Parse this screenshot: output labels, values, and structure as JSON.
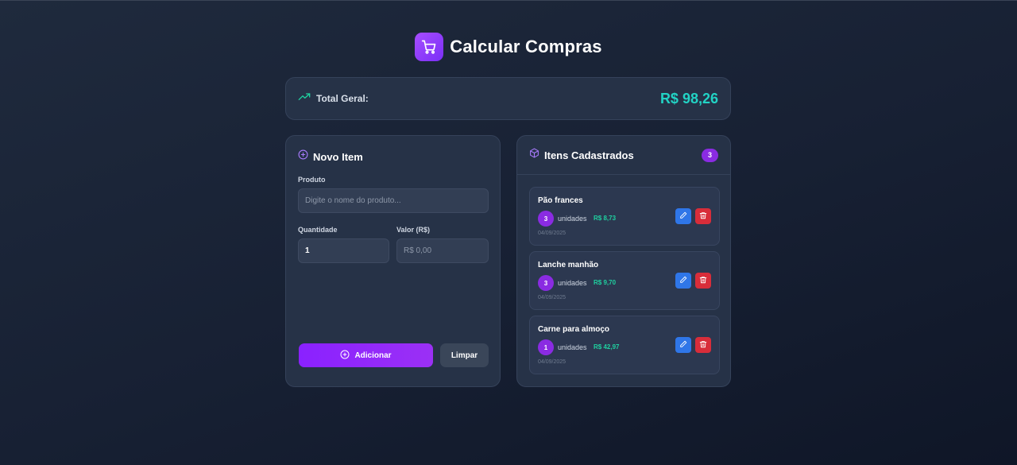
{
  "app": {
    "title": "Calcular Compras"
  },
  "summary": {
    "total_label": "Total Geral:",
    "total_value": "R$ 98,26"
  },
  "form": {
    "title": "Novo Item",
    "product_label": "Produto",
    "product_placeholder": "Digite o nome do produto...",
    "quantity_label": "Quantidade",
    "quantity_value": "1",
    "price_label": "Valor (R$)",
    "price_placeholder": "R$ 0,00",
    "add_label": "Adicionar",
    "clear_label": "Limpar"
  },
  "list": {
    "title": "Itens Cadastrados",
    "count": "3",
    "items": [
      {
        "name": "Pão frances",
        "qty": "3",
        "unit": "unidades",
        "price": "R$ 8,73",
        "date": "04/09/2025"
      },
      {
        "name": "Lanche manhão",
        "qty": "3",
        "unit": "unidades",
        "price": "R$ 9,70",
        "date": "04/09/2025"
      },
      {
        "name": "Carne para almoço",
        "qty": "1",
        "unit": "unidades",
        "price": "R$ 42,97",
        "date": "04/09/2025"
      }
    ]
  },
  "colors": {
    "accent_purple": "#8a21ff",
    "total_teal": "#22d3c5",
    "price_green": "#1fd1a0",
    "edit_blue": "#2f76e8",
    "delete_red": "#d82d3a"
  },
  "icons": [
    "cart-icon",
    "trending-up-icon",
    "plus-circle-icon",
    "box-icon",
    "pencil-icon",
    "trash-icon"
  ]
}
